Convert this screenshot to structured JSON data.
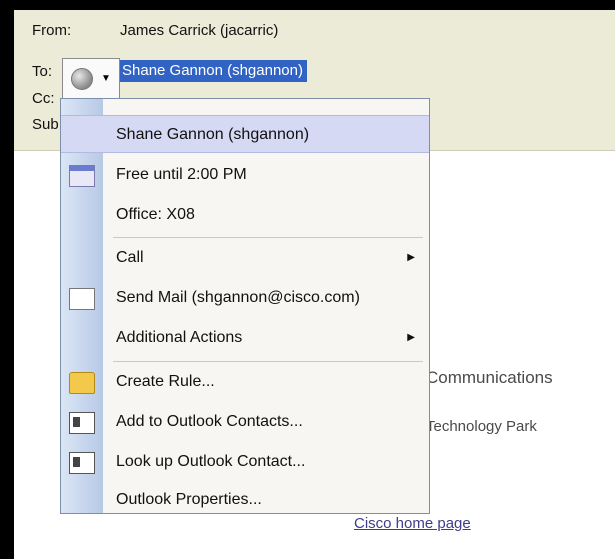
{
  "header": {
    "from_label": "From:",
    "from_value": "James Carrick (jacarric)",
    "to_label": "To:",
    "to_value": "Shane Gannon (shgannon)",
    "cc_label": "Cc:",
    "subject_label": "Sub"
  },
  "persona_icon": "presence-status-icon",
  "signature": {
    "line1": "Communications",
    "line2": "Technology Park",
    "link": "Cisco home page"
  },
  "menu": {
    "title": "Shane Gannon (shgannon)",
    "free_until": "Free until 2:00 PM",
    "office": "Office: X08",
    "call": "Call",
    "send_mail": "Send Mail (shgannon@cisco.com)",
    "additional_actions": "Additional Actions",
    "create_rule": "Create Rule...",
    "add_contacts": "Add to Outlook Contacts...",
    "lookup_contact": "Look up Outlook Contact...",
    "properties": "Outlook Properties..."
  }
}
